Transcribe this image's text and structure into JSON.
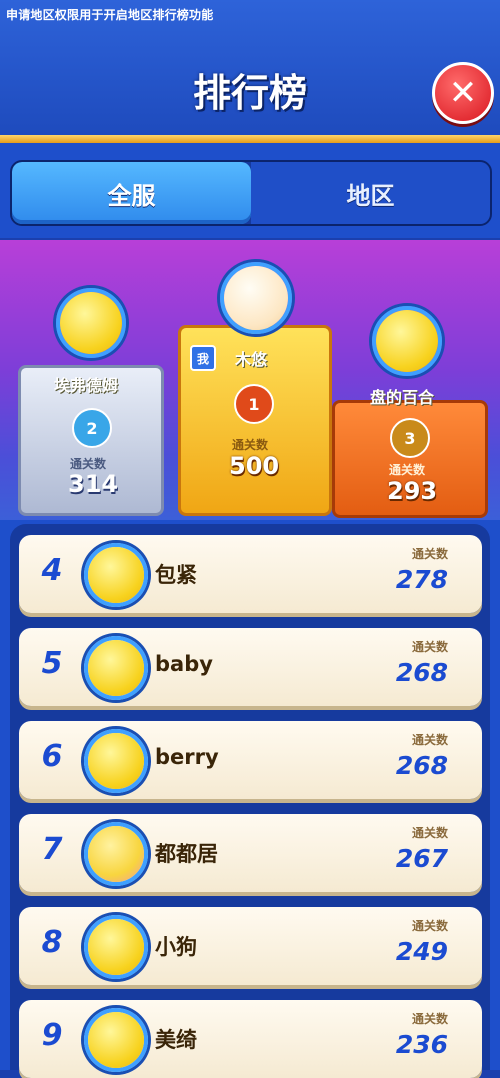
{
  "notice": "申请地区权限用于开启地区排行榜功能",
  "title": "排行榜",
  "close_icon": "close-icon",
  "tabs": [
    {
      "label": "全服",
      "active": true
    },
    {
      "label": "地区",
      "active": false
    }
  ],
  "podium": {
    "score_label": "通关数",
    "me_badge": "我",
    "first": {
      "name": "木悠",
      "rank": "1",
      "score": "500"
    },
    "second": {
      "name": "埃弗德姆",
      "rank": "2",
      "score": "314"
    },
    "third": {
      "name": "盘的百合",
      "rank": "3",
      "score": "293"
    }
  },
  "list": {
    "score_label": "通关数",
    "rows": [
      {
        "rank": "4",
        "name": "包紧",
        "score": "278"
      },
      {
        "rank": "5",
        "name": "baby",
        "score": "268"
      },
      {
        "rank": "6",
        "name": "berry",
        "score": "268"
      },
      {
        "rank": "7",
        "name": "都都居",
        "score": "267"
      },
      {
        "rank": "8",
        "name": "小狗",
        "score": "249"
      },
      {
        "rank": "9",
        "name": "美绮",
        "score": "236"
      }
    ]
  },
  "colors": {
    "accent": "#1b4bd1",
    "close": "#d9161f",
    "gold": "#f0a614"
  }
}
